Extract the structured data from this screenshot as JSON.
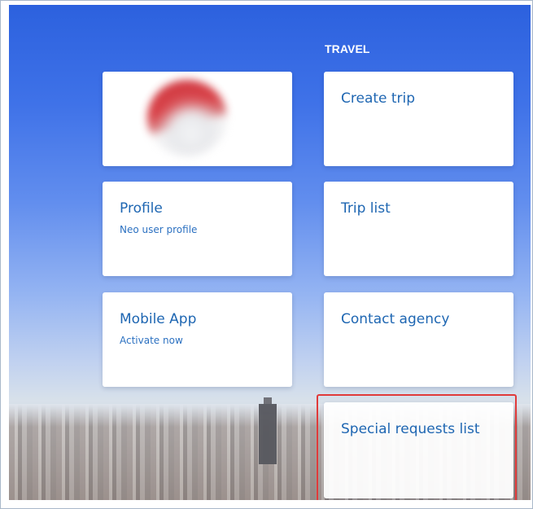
{
  "section": {
    "title": "TRAVEL"
  },
  "tiles": {
    "logo": {
      "icon": "blurred-red-circle-logo-icon"
    },
    "create_trip": {
      "label": "Create trip"
    },
    "profile": {
      "label": "Profile",
      "subtitle": "Neo user profile"
    },
    "trip_list": {
      "label": "Trip list"
    },
    "mobile_app": {
      "label": "Mobile App",
      "subtitle": "Activate now"
    },
    "contact_agency": {
      "label": "Contact agency"
    },
    "special_requests": {
      "label": "Special requests list"
    }
  },
  "colors": {
    "tile_text": "#1e66b2",
    "highlight": "#e03a3a",
    "sky_top": "#2c61de"
  }
}
